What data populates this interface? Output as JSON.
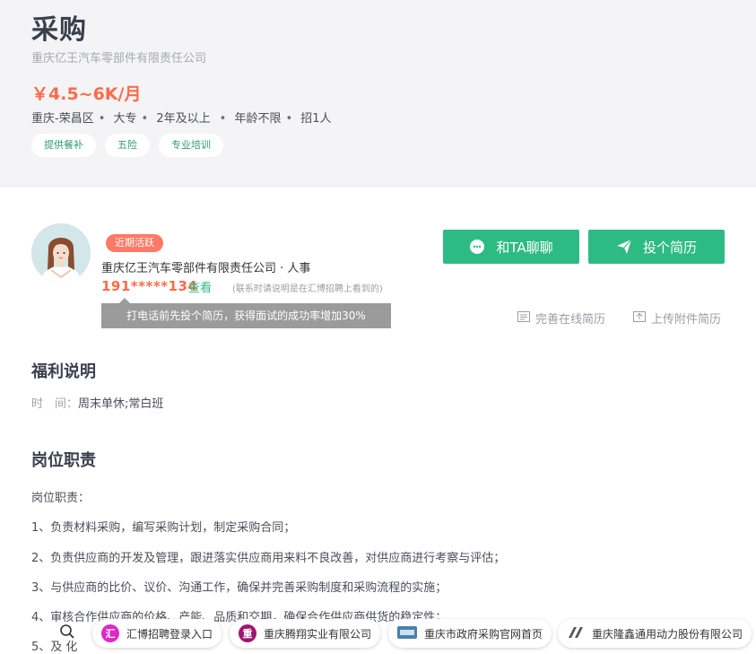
{
  "job": {
    "title": "采购",
    "company": "重庆亿王汽车零部件有限责任公司",
    "salary": "￥4.5~6K/月",
    "meta": [
      "重庆-荣昌区",
      "大专",
      "2年及以上",
      "年龄不限",
      "招1人"
    ],
    "tags": [
      "提供餐补",
      "五险",
      "专业培训"
    ]
  },
  "recruiter": {
    "active_badge": "近期活跃",
    "name_line": "重庆亿王汽车零部件有限责任公司 · 人事",
    "phone": "191*****134",
    "view_label": "查看",
    "phone_note": "(联系时请说明是在汇博招聘上看到的)",
    "tip": "打电话前先投个简历，获得面试的成功率增加30%"
  },
  "actions": {
    "chat_label": "和TA聊聊",
    "apply_label": "投个简历",
    "online_resume_label": "完善在线简历",
    "upload_resume_label": "上传附件简历"
  },
  "welfare": {
    "heading": "福利说明",
    "time_label": "时　间：",
    "time_value": "周末单休;常白班"
  },
  "duties": {
    "heading": "岗位职责",
    "lines": [
      "岗位职责：",
      "1、负责材料采购，编写采购计划，制定采购合同；",
      "2、负责供应商的开发及管理，跟进落实供应商用来料不良改善，对供应商进行考察与评估；",
      "3、与供应商的比价、议价、沟通工作，确保并完善采购制度和采购流程的实施；",
      "4、审核合作供应商的价格、产能、品质和交期，确保合作供应商供货的稳定性；",
      "5、及                                                    化"
    ]
  },
  "bottom_links": [
    {
      "label": "汇博招聘登录入口",
      "logo_text": "汇",
      "color": "#e026c8"
    },
    {
      "label": "重庆腾翔实业有限公司",
      "logo_text": "重",
      "color": "#a0166e"
    },
    {
      "label": "重庆市政府采购官网首页",
      "logo_text": "",
      "color": "#4a7fae"
    },
    {
      "label": "重庆隆鑫通用动力股份有限公司",
      "logo_text": "",
      "color": "#555555"
    }
  ],
  "colors": {
    "accent_green": "#2ebb83",
    "salary_orange": "#ff6a49",
    "header_bg": "#f4f4f6"
  }
}
